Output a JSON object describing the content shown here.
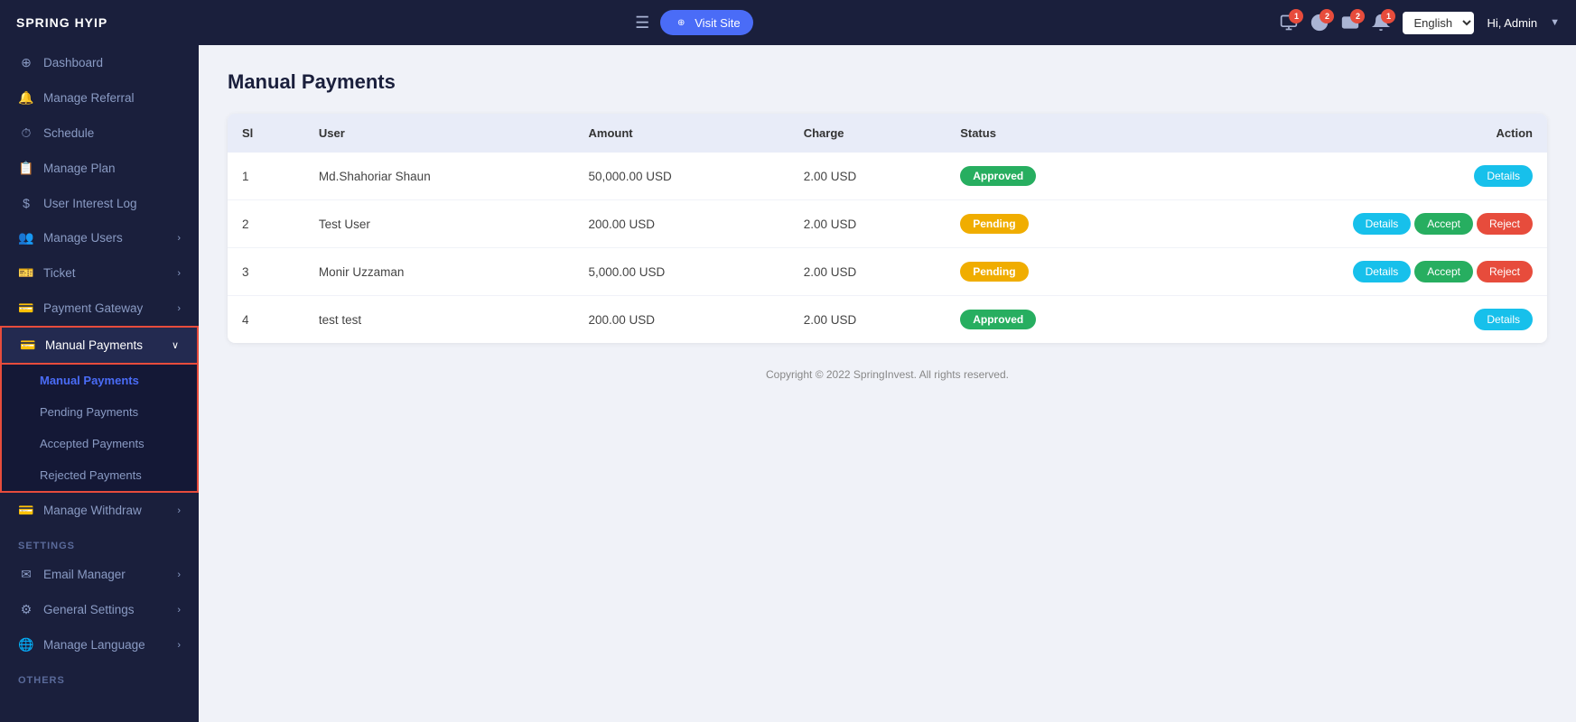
{
  "brand": "SPRING HYIP",
  "topnav": {
    "hamburger": "☰",
    "visit_btn": "Visit Site",
    "badges": [
      {
        "icon": "monitor-icon",
        "count": "1"
      },
      {
        "icon": "dollar-icon",
        "count": "2"
      },
      {
        "icon": "card-icon",
        "count": "2"
      },
      {
        "icon": "bell-icon",
        "count": "1"
      }
    ],
    "language": "English",
    "admin_label": "Hi, Admin"
  },
  "sidebar": {
    "items": [
      {
        "id": "dashboard",
        "label": "Dashboard",
        "icon": "⊕",
        "active": false
      },
      {
        "id": "manage-referral",
        "label": "Manage Referral",
        "icon": "🔔",
        "active": false
      },
      {
        "id": "schedule",
        "label": "Schedule",
        "icon": "⏱",
        "active": false
      },
      {
        "id": "manage-plan",
        "label": "Manage Plan",
        "icon": "⊕",
        "active": false
      },
      {
        "id": "user-interest-log",
        "label": "User Interest Log",
        "icon": "$",
        "active": false
      },
      {
        "id": "manage-users",
        "label": "Manage Users",
        "icon": "👥",
        "has_children": true,
        "active": false
      },
      {
        "id": "ticket",
        "label": "Ticket",
        "icon": "🎫",
        "has_children": true,
        "active": false
      },
      {
        "id": "payment-gateway",
        "label": "Payment Gateway",
        "icon": "💳",
        "has_children": true,
        "active": false
      },
      {
        "id": "manual-payments",
        "label": "Manual Payments",
        "icon": "💳",
        "has_children": true,
        "active": true
      },
      {
        "id": "manage-withdraw",
        "label": "Manage Withdraw",
        "icon": "💳",
        "has_children": true,
        "active": false
      }
    ],
    "manual_payments_sub": [
      {
        "id": "manual-payments-main",
        "label": "Manual Payments",
        "active": true
      },
      {
        "id": "pending-payments",
        "label": "Pending Payments",
        "active": false
      },
      {
        "id": "accepted-payments",
        "label": "Accepted Payments",
        "active": false
      },
      {
        "id": "rejected-payments",
        "label": "Rejected Payments",
        "active": false
      }
    ],
    "settings_label": "SETTINGS",
    "settings_items": [
      {
        "id": "email-manager",
        "label": "Email Manager",
        "has_children": true
      },
      {
        "id": "general-settings",
        "label": "General Settings",
        "has_children": true
      },
      {
        "id": "manage-language",
        "label": "Manage Language",
        "has_children": true
      }
    ],
    "others_label": "OTHERS"
  },
  "main": {
    "page_title": "Manual Payments",
    "table": {
      "headers": [
        "Sl",
        "User",
        "Amount",
        "Charge",
        "Status",
        "Action"
      ],
      "rows": [
        {
          "sl": "1",
          "user": "Md.Shahoriar Shaun",
          "amount": "50,000.00 USD",
          "charge": "2.00 USD",
          "status": "Approved",
          "status_type": "approved",
          "actions": [
            "Details"
          ]
        },
        {
          "sl": "2",
          "user": "Test User",
          "amount": "200.00 USD",
          "charge": "2.00 USD",
          "status": "Pending",
          "status_type": "pending",
          "actions": [
            "Details",
            "Accept",
            "Reject"
          ]
        },
        {
          "sl": "3",
          "user": "Monir Uzzaman",
          "amount": "5,000.00 USD",
          "charge": "2.00 USD",
          "status": "Pending",
          "status_type": "pending",
          "actions": [
            "Details",
            "Accept",
            "Reject"
          ]
        },
        {
          "sl": "4",
          "user": "test test",
          "amount": "200.00 USD",
          "charge": "2.00 USD",
          "status": "Approved",
          "status_type": "approved",
          "actions": [
            "Details"
          ]
        }
      ]
    },
    "footer": "Copyright © 2022 SpringInvest. All rights reserved."
  }
}
